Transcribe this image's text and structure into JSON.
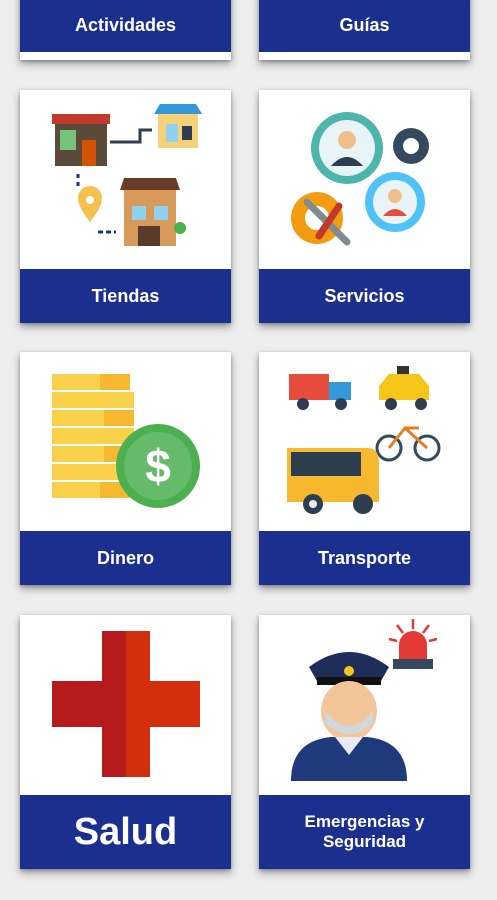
{
  "cards": [
    {
      "label": "Actividades",
      "icon": "activities-icon"
    },
    {
      "label": "Guías",
      "icon": "guides-icon"
    },
    {
      "label": "Tiendas",
      "icon": "shops-map-icon"
    },
    {
      "label": "Servicios",
      "icon": "services-gears-icon"
    },
    {
      "label": "Dinero",
      "icon": "money-coins-icon"
    },
    {
      "label": "Transporte",
      "icon": "transport-vehicles-icon"
    },
    {
      "label": "Salud",
      "icon": "red-cross-icon"
    },
    {
      "label": "Emergencias y Seguridad",
      "icon": "police-officer-siren-icon"
    }
  ],
  "colors": {
    "label_bg": "#1b2f8f",
    "page_bg": "#eeeeee"
  }
}
